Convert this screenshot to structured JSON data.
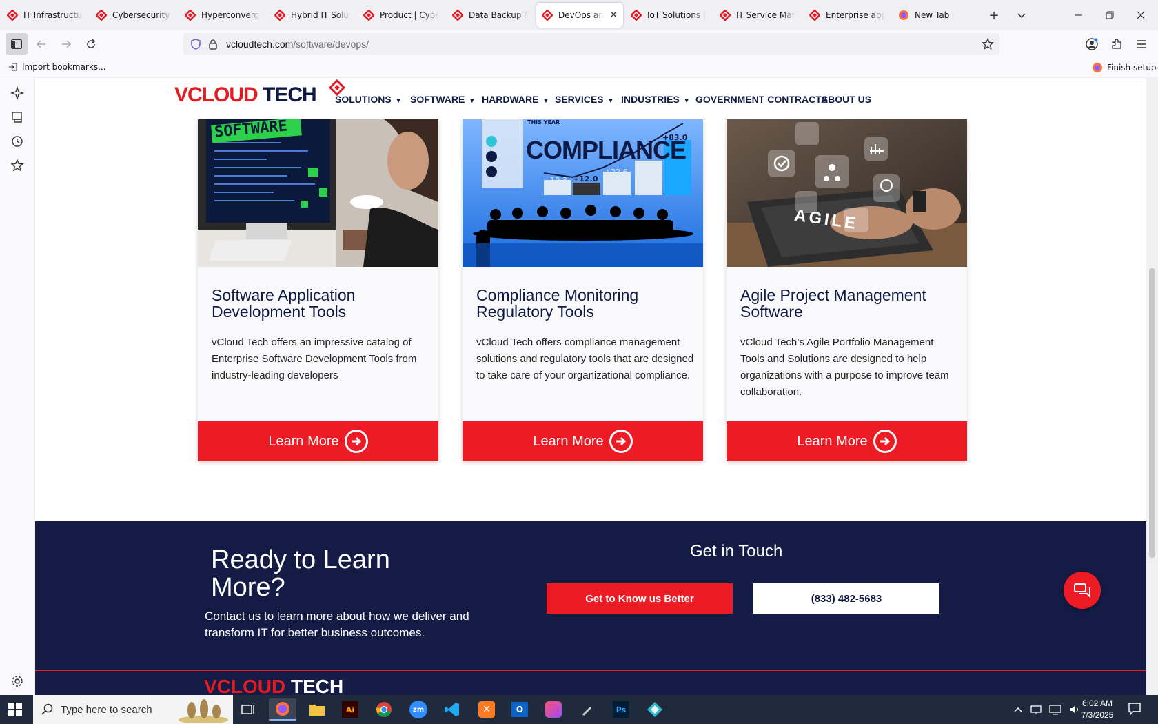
{
  "browser": {
    "tabs": [
      {
        "label": "IT Infrastructure"
      },
      {
        "label": "Cybersecurity So"
      },
      {
        "label": "Hyperconverged"
      },
      {
        "label": "Hybrid IT Solutio"
      },
      {
        "label": "Product | Cyber"
      },
      {
        "label": "Data Backup & D"
      },
      {
        "label": "DevOps and",
        "active": true
      },
      {
        "label": "IoT Solutions | In"
      },
      {
        "label": "IT Service Manag"
      },
      {
        "label": "Enterprise applic"
      },
      {
        "label": "New Tab"
      }
    ],
    "url_host": "vcloudtech.com",
    "url_path": "/software/devops/",
    "bookmark_import": "Import bookmarks...",
    "finish_setup": "Finish setup"
  },
  "site": {
    "logo": {
      "part1": "V",
      "part2": "CLOUD",
      "part3": " TECH"
    },
    "menu": [
      {
        "label": "SOLUTIONS",
        "dropdown": true
      },
      {
        "label": "SOFTWARE",
        "dropdown": true
      },
      {
        "label": "HARDWARE",
        "dropdown": true
      },
      {
        "label": "SERVICES",
        "dropdown": true
      },
      {
        "label": "INDUSTRIES",
        "dropdown": true
      },
      {
        "label": "GOVERNMENT CONTRACTS",
        "dropdown": false
      },
      {
        "label": "ABOUT US",
        "dropdown": false
      }
    ],
    "cards": [
      {
        "image_text": "SOFTWARE",
        "title": "Software Application Development Tools",
        "description": "vCloud Tech offers an impressive catalog of Enterprise Software Development Tools from industry-leading developers",
        "button": "Learn More"
      },
      {
        "image_text": "COMPLIANCE",
        "image_labels": [
          "THIS YEAR",
          "+83.0",
          "+41.9",
          "+22.6",
          "+12.0",
          "+10.3"
        ],
        "title": "Compliance Monitoring Regulatory Tools",
        "description": "vCloud Tech offers compliance management solutions and regulatory tools that are designed to take care of your organizational compliance.",
        "button": "Learn More"
      },
      {
        "image_text": "AGILE",
        "title": "Agile Project Management Software",
        "description": "vCloud Tech’s Agile Portfolio Management Tools and Solutions are designed to help organizations with a purpose to improve team collaboration.",
        "button": "Learn More"
      }
    ],
    "cta": {
      "heading": "Ready to Learn More?",
      "subtext": "Contact us to learn more about how we deliver and transform IT for better business outcomes.",
      "get_in_touch": "Get in Touch",
      "button_primary": "Get to Know us Better",
      "button_phone": "(833) 482-5683"
    }
  },
  "taskbar": {
    "search_placeholder": "Type here to search",
    "time": "6:02 AM",
    "date": "7/3/2025"
  },
  "colors": {
    "brand_red": "#ed1c24",
    "brand_navy": "#141b45"
  }
}
